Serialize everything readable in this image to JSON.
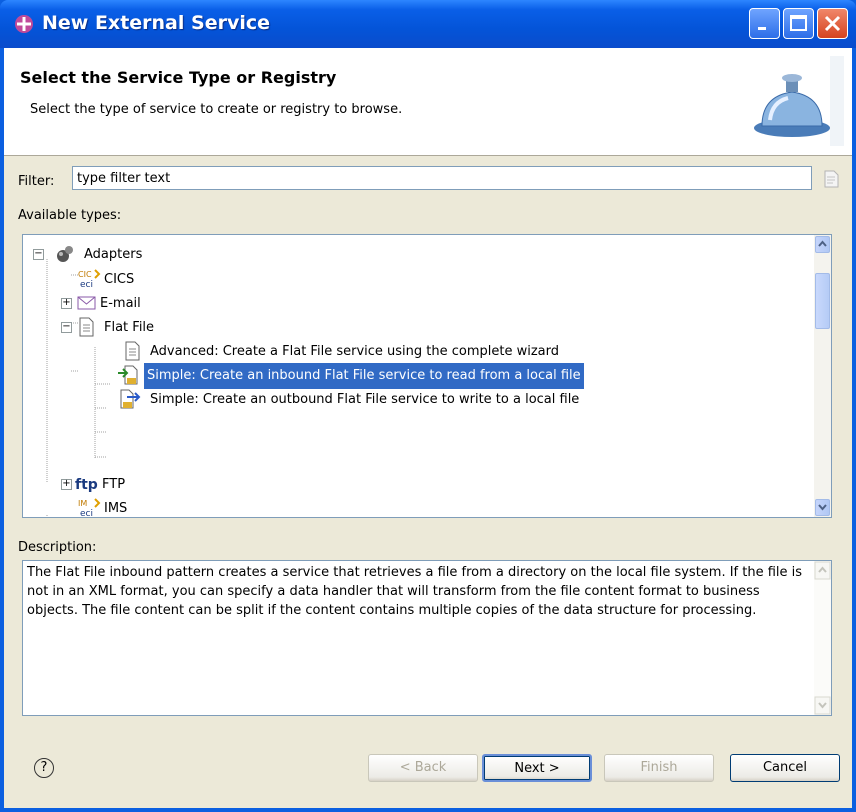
{
  "window": {
    "title": "New External Service"
  },
  "header": {
    "title": "Select the Service Type or Registry",
    "subtitle": "Select the type of service to create or registry to browse."
  },
  "filter": {
    "label": "Filter:",
    "value": "type filter text"
  },
  "types": {
    "label": "Available types:",
    "tree": [
      {
        "label": "Adapters",
        "icon": "adapters-icon",
        "expander": "minus"
      },
      {
        "label": "CICS",
        "icon": "cics-eci-icon"
      },
      {
        "label": "E-mail",
        "icon": "envelope-icon",
        "expander": "plus"
      },
      {
        "label": "Flat File",
        "icon": "file-icon",
        "expander": "minus"
      },
      {
        "label": "Advanced: Create a  Flat File service using the complete wizard",
        "icon": "file-icon"
      },
      {
        "label": "Simple: Create an inbound Flat File service to read from a local file",
        "icon": "inbound-file-icon",
        "selected": true
      },
      {
        "label": "Simple: Create an outbound Flat File service to write to a local file",
        "icon": "outbound-file-icon"
      },
      {
        "label": "FTP",
        "icon": "ftp-icon",
        "expander": "plus"
      },
      {
        "label": "IMS",
        "icon": "ims-eci-icon"
      }
    ]
  },
  "description": {
    "label": "Description:",
    "text": "The Flat File inbound pattern creates a service that retrieves a file from a directory on the local file system. If the file is not in an XML format, you can specify a data handler that will transform from the file content format to business objects. The file content can be split if the content contains multiple copies of the data structure for processing."
  },
  "buttons": {
    "back": "< Back",
    "next": "Next >",
    "finish": "Finish",
    "cancel": "Cancel"
  },
  "tree_glyphs": {
    "plus": "+",
    "minus": "−"
  },
  "icon_text": {
    "cics_top": "CIC",
    "ims_top": "IM",
    "eci": "eci",
    "ftp": "ftp",
    "help": "?"
  },
  "colors": {
    "titlebar": "#0a5fe8",
    "selection": "#316ac5",
    "dialog_bg": "#ece9d8"
  }
}
